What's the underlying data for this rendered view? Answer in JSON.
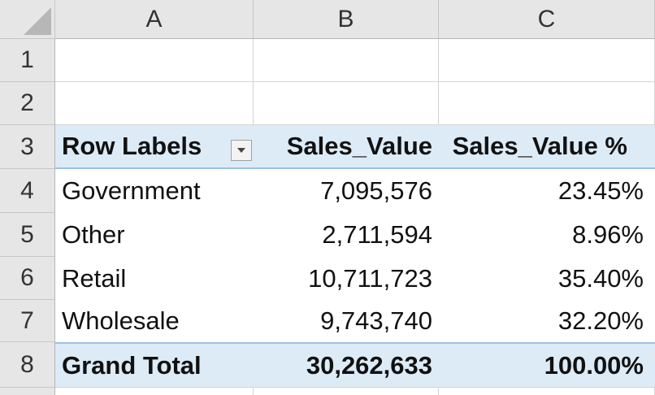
{
  "columns": [
    "A",
    "B",
    "C"
  ],
  "rows": [
    "1",
    "2",
    "3",
    "4",
    "5",
    "6",
    "7",
    "8"
  ],
  "pivot": {
    "header": {
      "row_labels": "Row Labels",
      "sales_value": "Sales_Value",
      "sales_value_pct": "Sales_Value %"
    },
    "body": [
      {
        "label": "Government",
        "value": "7,095,576",
        "pct": "23.45%"
      },
      {
        "label": "Other",
        "value": "2,711,594",
        "pct": "8.96%"
      },
      {
        "label": "Retail",
        "value": "10,711,723",
        "pct": "35.40%"
      },
      {
        "label": "Wholesale",
        "value": "9,743,740",
        "pct": "32.20%"
      }
    ],
    "total": {
      "label": "Grand Total",
      "value": "30,262,633",
      "pct": "100.00%"
    }
  },
  "icons": {
    "filter": "dropdown-arrow-icon"
  },
  "colors": {
    "pivot_fill": "#ddebf7",
    "pivot_border": "#9bc2e6",
    "header_fill": "#e6e6e6"
  }
}
